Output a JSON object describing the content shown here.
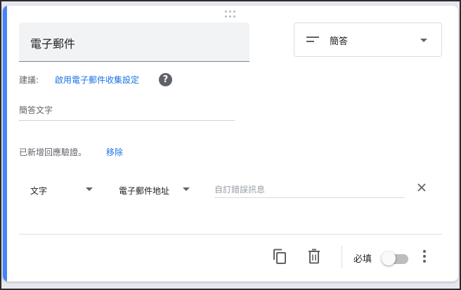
{
  "question": {
    "title": "電子郵件",
    "type_label": "簡答",
    "type_icon": "short-answer-icon"
  },
  "suggestion": {
    "label": "建議:",
    "link": "啟用電子郵件收集設定",
    "help_icon": "?"
  },
  "answer_placeholder": "簡答文字",
  "validation": {
    "status_text": "已新增回應驗證。",
    "remove_label": "移除",
    "type_value": "文字",
    "condition_value": "電子郵件地址",
    "error_placeholder": "自訂錯誤訊息"
  },
  "footer": {
    "required_label": "必填",
    "required_on": false
  },
  "colors": {
    "accent": "#4285f4",
    "link": "#1a73e8"
  }
}
